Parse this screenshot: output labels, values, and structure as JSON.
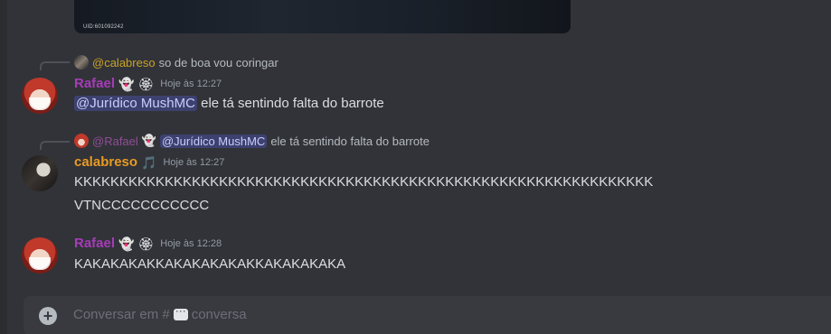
{
  "embed": {
    "uid_text": "UID:601092242"
  },
  "messages": [
    {
      "reply": {
        "author": "@calabreso",
        "text": "so de boa vou coringar"
      },
      "author": "Rafael",
      "badges": [
        "👻",
        "🏵"
      ],
      "timestamp": "Hoje às 12:27",
      "mention": "@Jurídico MushMC",
      "text": "ele tá sentindo falta do barrote"
    },
    {
      "reply": {
        "author": "@Rafael",
        "mention": "@Jurídico MushMC",
        "text": "ele tá sentindo falta do barrote"
      },
      "author": "calabreso",
      "badges": [
        "🎵"
      ],
      "timestamp": "Hoje às 12:27",
      "lines": [
        "KKKKKKKKKKKKKKKKKKKKKKKKKKKKKKKKKKKKKKKKKKKKKKKKKKKKKKKKKKKKKKKK",
        "VTNCCCCCCCCCCC"
      ]
    },
    {
      "author": "Rafael",
      "badges": [
        "👻",
        "🏵"
      ],
      "timestamp": "Hoje às 12:28",
      "text": "KAKAKAKAKKAKAKAKAKAKKAKAKAKAKA"
    }
  ],
  "composer": {
    "placeholder_prefix": "Conversar em #",
    "placeholder_channel": "conversa",
    "plus_icon": "+"
  },
  "colors": {
    "background": "#313338",
    "rafael": "#a63cb8",
    "calabreso": "#e89a23",
    "mention_bg": "#5865f24d"
  }
}
